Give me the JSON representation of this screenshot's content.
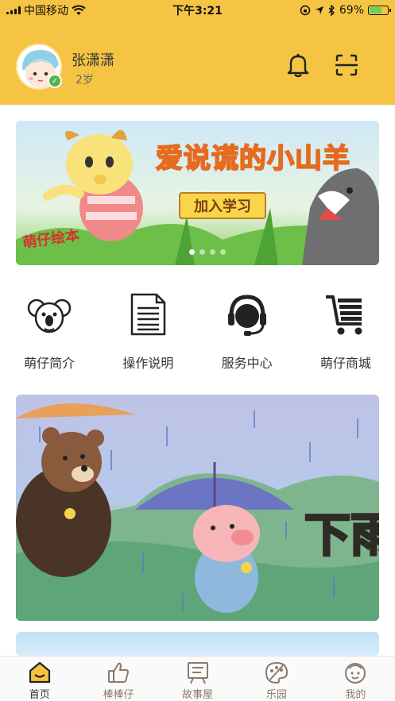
{
  "status_bar": {
    "carrier": "中国移动",
    "time": "下午3:21",
    "battery_percent": "69%",
    "battery_level": 0.69
  },
  "header": {
    "user_name": "张潇潇",
    "user_age": "2岁"
  },
  "banner_top": {
    "title": "爱说谎的小山羊",
    "button_label": "加入学习",
    "logo_text": "萌仔绘本",
    "page_count": 4,
    "active_page": 1
  },
  "quick_menu": [
    {
      "label": "萌仔简介",
      "icon": "koala-icon"
    },
    {
      "label": "操作说明",
      "icon": "document-icon"
    },
    {
      "label": "服务中心",
      "icon": "headset-icon"
    },
    {
      "label": "萌仔商城",
      "icon": "cart-icon"
    }
  ],
  "banner_middle": {
    "text": "下雨"
  },
  "tab_bar": [
    {
      "label": "首页",
      "icon": "home-icon",
      "active": true
    },
    {
      "label": "棒棒仔",
      "icon": "thumbs-up-icon",
      "active": false
    },
    {
      "label": "故事屋",
      "icon": "story-board-icon",
      "active": false
    },
    {
      "label": "乐园",
      "icon": "palette-icon",
      "active": false
    },
    {
      "label": "我的",
      "icon": "profile-face-icon",
      "active": false
    }
  ],
  "colors": {
    "brand_yellow": "#f5c443",
    "tab_active": "#333333",
    "tab_inactive": "#8a7a6a"
  }
}
